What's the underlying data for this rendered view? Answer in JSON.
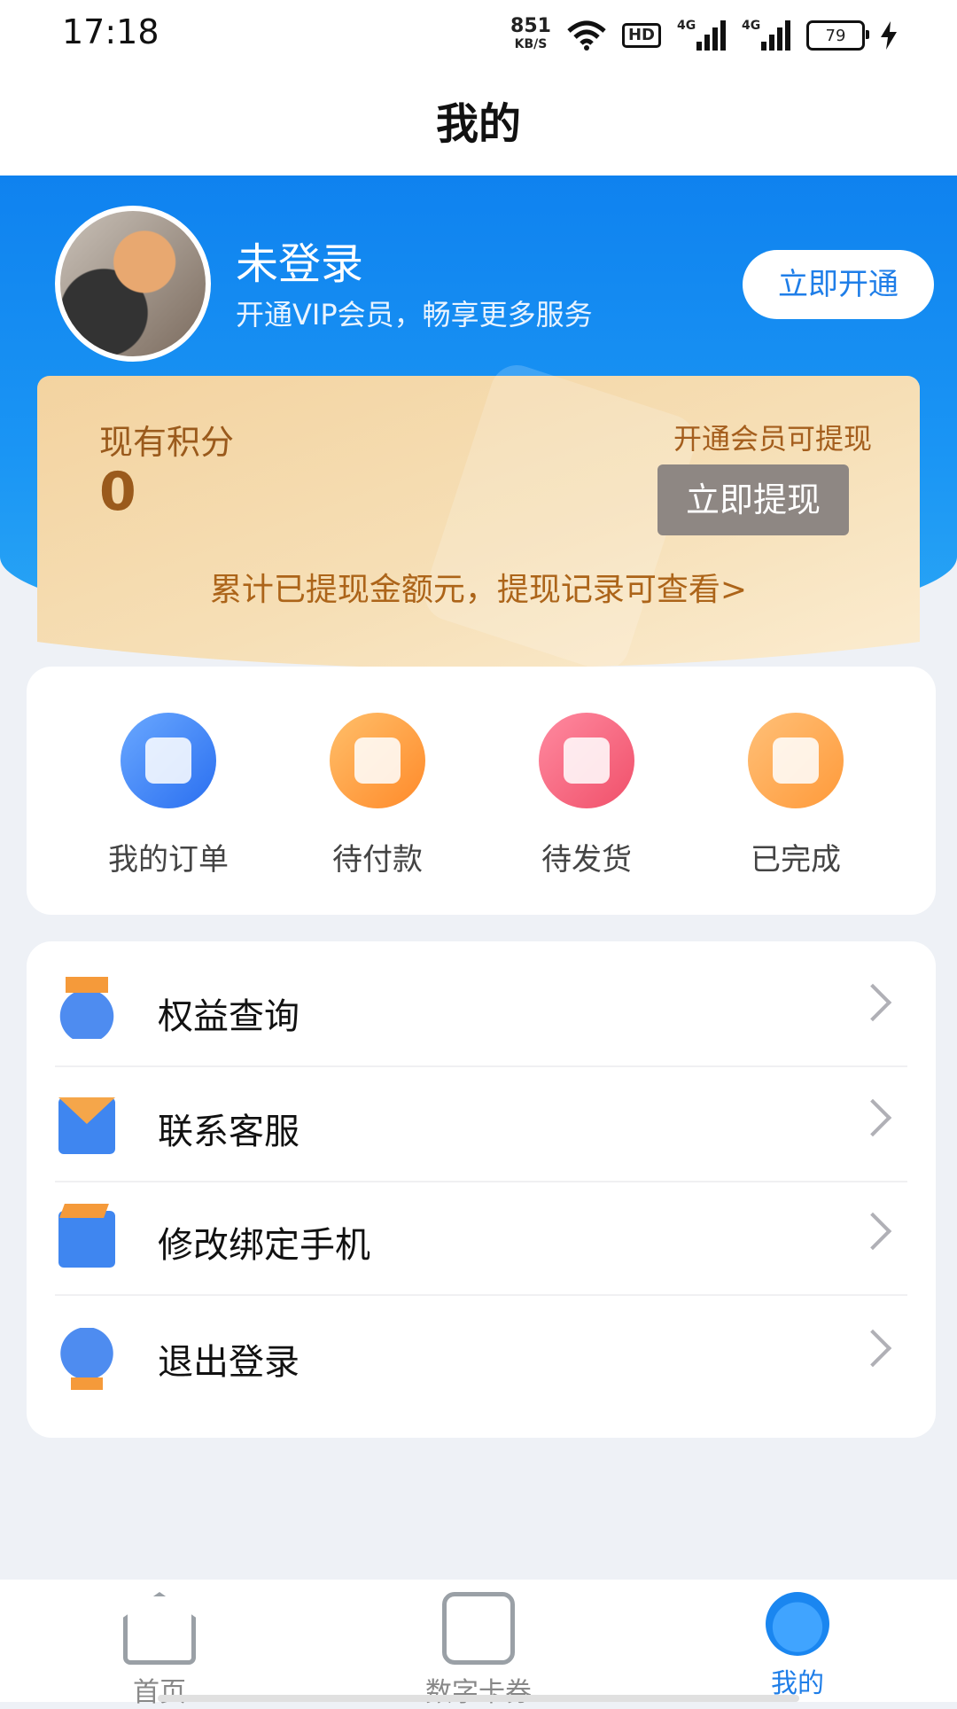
{
  "status_bar": {
    "time": "17:18",
    "net_speed_value": "851",
    "net_speed_unit": "KB/S",
    "hd_label": "HD",
    "signal1_label": "4G",
    "signal2_label": "4G",
    "battery": "79"
  },
  "header": {
    "title": "我的"
  },
  "profile": {
    "name": "未登录",
    "subtitle": "开通VIP会员，畅享更多服务",
    "open_button": "立即开通"
  },
  "points": {
    "label": "现有积分",
    "value": "0",
    "hint": "开通会员可提现",
    "withdraw_button": "立即提现",
    "note": "累计已提现金额元，提现记录可查看>"
  },
  "orders": {
    "items": [
      {
        "label": "我的订单",
        "icon": "order-list-icon",
        "color": "#2a6ff0"
      },
      {
        "label": "待付款",
        "icon": "wallet-icon",
        "color": "#ff8a2a"
      },
      {
        "label": "待发货",
        "icon": "gift-icon",
        "color": "#f0506a"
      },
      {
        "label": "已完成",
        "icon": "completed-chart-icon",
        "color": "#ff9a3a"
      }
    ]
  },
  "menu": {
    "items": [
      {
        "label": "权益查询",
        "icon": "medal-icon"
      },
      {
        "label": "联系客服",
        "icon": "mail-alert-icon"
      },
      {
        "label": "修改绑定手机",
        "icon": "link-icon"
      },
      {
        "label": "退出登录",
        "icon": "logout-icon"
      }
    ]
  },
  "tabbar": {
    "items": [
      {
        "label": "首页",
        "icon": "home-icon"
      },
      {
        "label": "数字卡券",
        "icon": "card-icon"
      },
      {
        "label": "我的",
        "icon": "profile-icon"
      }
    ],
    "active_index": 2,
    "active_color": "#1f7ee8"
  }
}
